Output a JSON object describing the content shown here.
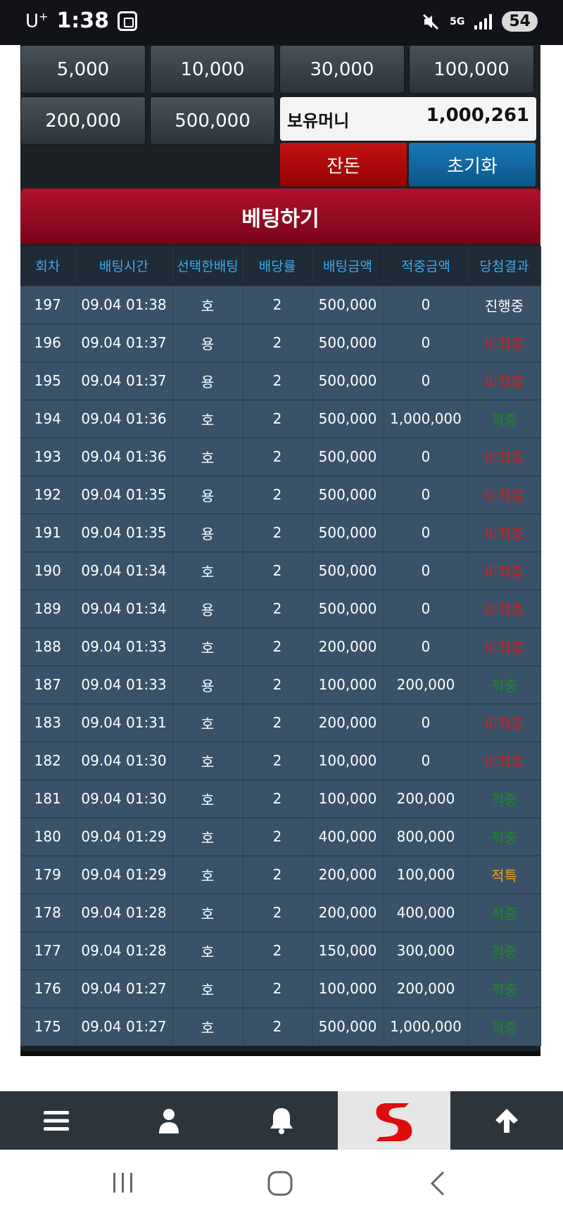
{
  "status_bar": {
    "carrier": "U",
    "carrier_sup": "+",
    "time": "1:38",
    "network": "5G",
    "battery": "54"
  },
  "chips": [
    "5,000",
    "10,000",
    "30,000",
    "100,000",
    "200,000",
    "500,000"
  ],
  "money": {
    "label": "보유머니",
    "value": "1,000,261"
  },
  "buttons": {
    "all_in": "잔돈",
    "reset": "초기화",
    "bet": "베팅하기"
  },
  "table": {
    "headers": [
      "회차",
      "배팅시간",
      "선택한배팅",
      "배당률",
      "배팅금액",
      "적중금액",
      "당첨결과"
    ],
    "rows": [
      {
        "round": "197",
        "time": "09.04 01:38",
        "pick": "호",
        "odds": "2",
        "bet": "500,000",
        "win": "0",
        "result": "진행중",
        "status": "pending"
      },
      {
        "round": "196",
        "time": "09.04 01:37",
        "pick": "용",
        "odds": "2",
        "bet": "500,000",
        "win": "0",
        "result": "미적중",
        "status": "lose"
      },
      {
        "round": "195",
        "time": "09.04 01:37",
        "pick": "용",
        "odds": "2",
        "bet": "500,000",
        "win": "0",
        "result": "미적중",
        "status": "lose"
      },
      {
        "round": "194",
        "time": "09.04 01:36",
        "pick": "호",
        "odds": "2",
        "bet": "500,000",
        "win": "1,000,000",
        "result": "적중",
        "status": "win"
      },
      {
        "round": "193",
        "time": "09.04 01:36",
        "pick": "호",
        "odds": "2",
        "bet": "500,000",
        "win": "0",
        "result": "미적중",
        "status": "lose"
      },
      {
        "round": "192",
        "time": "09.04 01:35",
        "pick": "용",
        "odds": "2",
        "bet": "500,000",
        "win": "0",
        "result": "미적중",
        "status": "lose"
      },
      {
        "round": "191",
        "time": "09.04 01:35",
        "pick": "용",
        "odds": "2",
        "bet": "500,000",
        "win": "0",
        "result": "미적중",
        "status": "lose"
      },
      {
        "round": "190",
        "time": "09.04 01:34",
        "pick": "호",
        "odds": "2",
        "bet": "500,000",
        "win": "0",
        "result": "미적중",
        "status": "lose"
      },
      {
        "round": "189",
        "time": "09.04 01:34",
        "pick": "용",
        "odds": "2",
        "bet": "500,000",
        "win": "0",
        "result": "미적중",
        "status": "lose"
      },
      {
        "round": "188",
        "time": "09.04 01:33",
        "pick": "호",
        "odds": "2",
        "bet": "200,000",
        "win": "0",
        "result": "미적중",
        "status": "lose"
      },
      {
        "round": "187",
        "time": "09.04 01:33",
        "pick": "용",
        "odds": "2",
        "bet": "100,000",
        "win": "200,000",
        "result": "적중",
        "status": "win"
      },
      {
        "round": "183",
        "time": "09.04 01:31",
        "pick": "호",
        "odds": "2",
        "bet": "200,000",
        "win": "0",
        "result": "미적중",
        "status": "lose"
      },
      {
        "round": "182",
        "time": "09.04 01:30",
        "pick": "호",
        "odds": "2",
        "bet": "100,000",
        "win": "0",
        "result": "미적중",
        "status": "lose"
      },
      {
        "round": "181",
        "time": "09.04 01:30",
        "pick": "호",
        "odds": "2",
        "bet": "100,000",
        "win": "200,000",
        "result": "적중",
        "status": "win"
      },
      {
        "round": "180",
        "time": "09.04 01:29",
        "pick": "호",
        "odds": "2",
        "bet": "400,000",
        "win": "800,000",
        "result": "적중",
        "status": "win"
      },
      {
        "round": "179",
        "time": "09.04 01:29",
        "pick": "호",
        "odds": "2",
        "bet": "200,000",
        "win": "100,000",
        "result": "적특",
        "status": "special"
      },
      {
        "round": "178",
        "time": "09.04 01:28",
        "pick": "호",
        "odds": "2",
        "bet": "200,000",
        "win": "400,000",
        "result": "적중",
        "status": "win"
      },
      {
        "round": "177",
        "time": "09.04 01:28",
        "pick": "호",
        "odds": "2",
        "bet": "150,000",
        "win": "300,000",
        "result": "적중",
        "status": "win"
      },
      {
        "round": "176",
        "time": "09.04 01:27",
        "pick": "호",
        "odds": "2",
        "bet": "100,000",
        "win": "200,000",
        "result": "적중",
        "status": "win"
      },
      {
        "round": "175",
        "time": "09.04 01:27",
        "pick": "호",
        "odds": "2",
        "bet": "500,000",
        "win": "1,000,000",
        "result": "적중",
        "status": "win"
      }
    ]
  },
  "status_colors": {
    "pending": "#ffffff",
    "lose": "#d11e1e",
    "win": "#1b8b24",
    "special": "#f3a21d"
  },
  "bottom_nav": [
    "menu-icon",
    "user-icon",
    "bell-icon",
    "logo-icon",
    "arrow-up-icon"
  ],
  "system_nav": [
    "recents-icon",
    "home-icon",
    "back-icon"
  ]
}
